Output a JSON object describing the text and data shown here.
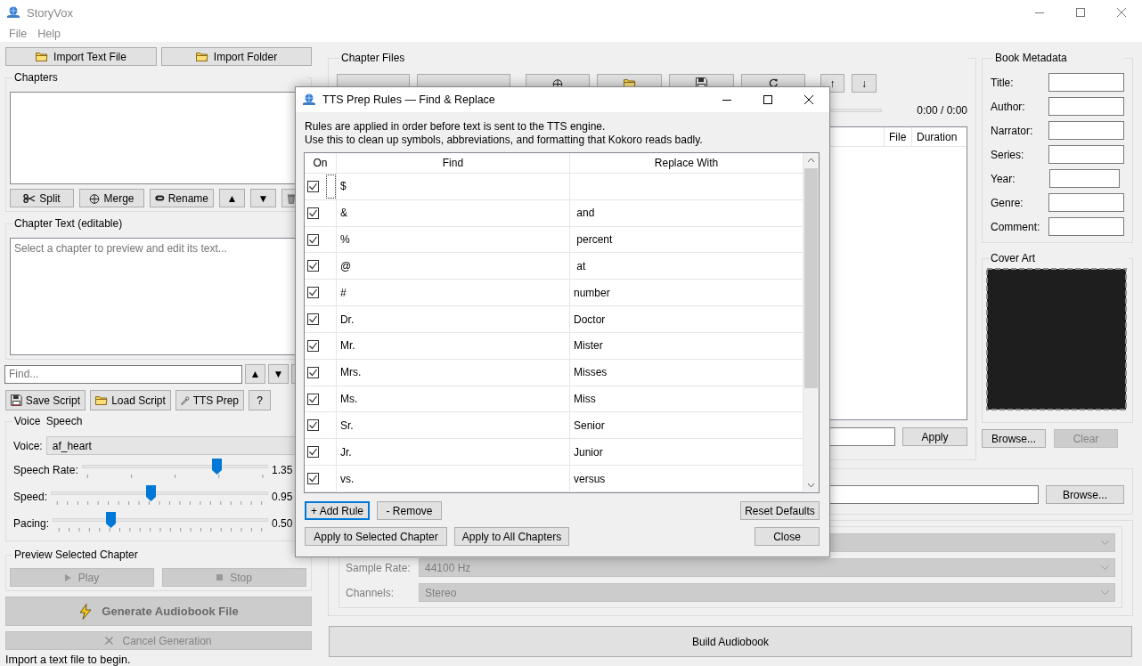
{
  "window": {
    "title": "StoryVox"
  },
  "menu": [
    "File",
    "Help"
  ],
  "import_buttons": [
    {
      "label": "Import Text File",
      "kind": "folder"
    },
    {
      "label": "Import Folder",
      "kind": "folder"
    }
  ],
  "chapters": {
    "title": "Chapters",
    "buttons": [
      {
        "label": "Split",
        "kind": "scissors"
      },
      {
        "label": "Merge",
        "kind": "merge"
      },
      {
        "label": "Rename",
        "kind": "tag"
      },
      {
        "label": "▲"
      },
      {
        "label": "▼"
      },
      {
        "kind": "trash"
      }
    ]
  },
  "chapter_text": {
    "title": "Chapter Text (editable)",
    "placeholder": "Select a chapter to preview and edit its text..."
  },
  "find": {
    "placeholder": "Find...",
    "buttons": [
      "▲",
      "▼"
    ]
  },
  "script_buttons": [
    {
      "label": "Save Script",
      "kind": "disk"
    },
    {
      "label": "Load Script",
      "kind": "folder"
    },
    {
      "label": "TTS Prep",
      "kind": "wrench"
    },
    {
      "label": "?"
    }
  ],
  "voice": {
    "title": "Voice Speech",
    "label": "Voice:",
    "value": "af_heart",
    "sliders": [
      {
        "label": "Speech Rate:",
        "level": 0.74,
        "reading": "1.35",
        "kind": "coarse"
      },
      {
        "label": "Speed:",
        "level": 0.46,
        "reading": "0.95",
        "kind": "fine"
      },
      {
        "label": "Pacing:",
        "level": 0.26,
        "reading": "0.50",
        "kind": "fine"
      }
    ]
  },
  "preview": {
    "title": "Preview Selected Chapter",
    "buttons": [
      {
        "label": "Play",
        "kind": "play",
        "disabled": true
      },
      {
        "label": "Stop",
        "kind": "stop",
        "disabled": true
      }
    ]
  },
  "generate": {
    "label": "Generate Audiobook File",
    "disabled": true
  },
  "cancel": {
    "label": "Cancel Generation",
    "disabled": true
  },
  "status_bar": "Import a text file to begin.",
  "chapter_files": {
    "title": "Chapter Files",
    "buttons": [
      {
        "kind": "plain"
      },
      {
        "kind": "plain"
      },
      {
        "kind": "merge"
      },
      {
        "kind": "folder"
      },
      {
        "kind": "disk"
      },
      {
        "kind": "refresh"
      },
      {
        "label": "↑"
      },
      {
        "label": "↓"
      }
    ],
    "progress": {
      "level": 0
    },
    "time": "0:00 / 0:00",
    "columns": [
      "File",
      "Duration"
    ],
    "apply_button": "Apply"
  },
  "metadata": {
    "title": "Book Metadata",
    "fields": [
      {
        "label": "Title:",
        "kind": "wide"
      },
      {
        "label": "Author:",
        "kind": "wide"
      },
      {
        "label": "Narrator:",
        "kind": "wide"
      },
      {
        "label": "Series:",
        "kind": "wide"
      },
      {
        "label": "Year:",
        "kind": "short"
      },
      {
        "label": "Genre:",
        "kind": "wide"
      },
      {
        "label": "Comment:",
        "kind": "wide"
      }
    ]
  },
  "cover_art": {
    "title": "Cover Art",
    "buttons": [
      {
        "label": "Browse...",
        "disabled": false
      },
      {
        "label": "Clear",
        "disabled": true
      }
    ]
  },
  "output": {
    "browse_button": "Browse..."
  },
  "format": {
    "combos": [
      {
        "label": "Sample Rate:",
        "value": "44100 Hz"
      },
      {
        "label": "Channels:",
        "value": "Stereo"
      }
    ]
  },
  "build_button": "Build Audiobook",
  "dialog": {
    "title": "TTS Prep Rules — Find & Replace",
    "description": [
      "Rules are applied in order before text is sent to the TTS engine.",
      "Use this to clean up symbols, abbreviations, and formatting that Kokoro reads badly."
    ],
    "columns": [
      "On",
      "Find",
      "Replace With"
    ],
    "rules": [
      {
        "on": true,
        "find": "$",
        "focused": true
      },
      {
        "on": true,
        "find": "&",
        "replace": " and",
        "focused": false
      },
      {
        "on": true,
        "find": "%",
        "replace": " percent",
        "focused": false
      },
      {
        "on": true,
        "find": "@",
        "replace": " at",
        "focused": false
      },
      {
        "on": true,
        "find": "#",
        "replace": "number",
        "focused": false
      },
      {
        "on": true,
        "find": "Dr.",
        "replace": "Doctor",
        "focused": false
      },
      {
        "on": true,
        "find": "Mr.",
        "replace": "Mister",
        "focused": false
      },
      {
        "on": true,
        "find": "Mrs.",
        "replace": "Misses",
        "focused": false
      },
      {
        "on": true,
        "find": "Ms.",
        "replace": "Miss",
        "focused": false
      },
      {
        "on": true,
        "find": "Sr.",
        "replace": "Senior",
        "focused": false
      },
      {
        "on": true,
        "find": "Jr.",
        "replace": "Junior",
        "focused": false
      },
      {
        "on": true,
        "find": "vs.",
        "replace": "versus",
        "focused": false
      }
    ],
    "buttons": [
      {
        "label": "+ Add Rule",
        "focused": true
      },
      {
        "label": "- Remove",
        "focused": false
      },
      {
        "label": "Reset Defaults",
        "focused": false
      }
    ],
    "apply_buttons": [
      "Apply to Selected Chapter",
      "Apply to All Chapters",
      "Close"
    ]
  }
}
